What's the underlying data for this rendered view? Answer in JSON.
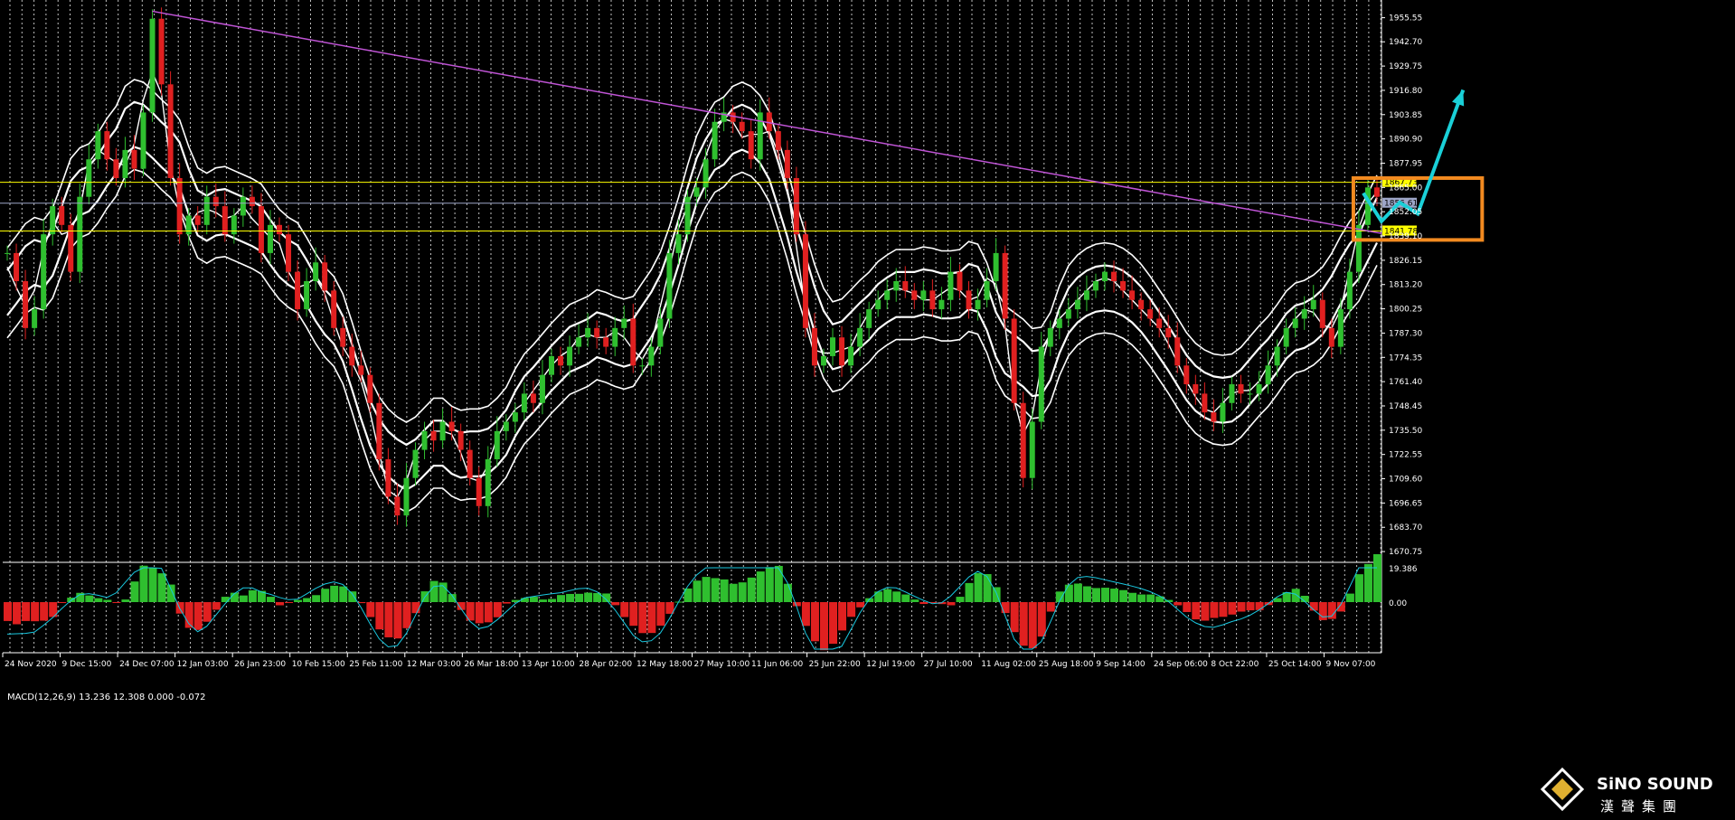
{
  "chart_data": [
    {
      "type": "candlestick",
      "name_panel": "main",
      "ylim": [
        1665.0,
        1965.0
      ],
      "yticks": [
        "1955.55",
        "1942.70",
        "1929.75",
        "1916.80",
        "1903.85",
        "1890.90",
        "1877.95",
        "1865.00",
        "1852.05",
        "1839.10",
        "1826.15",
        "1813.20",
        "1800.25",
        "1787.30",
        "1774.35",
        "1761.40",
        "1748.45",
        "1735.50",
        "1722.55",
        "1709.60",
        "1696.65",
        "1683.70",
        "1670.75"
      ],
      "xticks": [
        "24 Nov 2020",
        "9 Dec 15:00",
        "24 Dec 07:00",
        "12 Jan 03:00",
        "26 Jan 23:00",
        "10 Feb 15:00",
        "25 Feb 11:00",
        "12 Mar 03:00",
        "26 Mar 18:00",
        "13 Apr 10:00",
        "28 Apr 02:00",
        "12 May 18:00",
        "27 May 10:00",
        "11 Jun 06:00",
        "25 Jun 22:00",
        "12 Jul 19:00",
        "27 Jul 10:00",
        "11 Aug 02:00",
        "25 Aug 18:00",
        "9 Sep 14:00",
        "24 Sep 06:00",
        "8 Oct 22:00",
        "25 Oct 14:00",
        "9 Nov 07:00"
      ],
      "price_series": [
        1830,
        1815,
        1790,
        1800,
        1840,
        1855,
        1845,
        1820,
        1860,
        1880,
        1895,
        1880,
        1870,
        1885,
        1875,
        1905,
        1955,
        1920,
        1870,
        1840,
        1850,
        1845,
        1860,
        1855,
        1840,
        1850,
        1860,
        1855,
        1830,
        1845,
        1840,
        1820,
        1800,
        1815,
        1825,
        1810,
        1790,
        1780,
        1770,
        1765,
        1750,
        1720,
        1700,
        1690,
        1710,
        1725,
        1735,
        1730,
        1740,
        1735,
        1725,
        1710,
        1695,
        1720,
        1735,
        1740,
        1745,
        1755,
        1750,
        1765,
        1775,
        1770,
        1780,
        1785,
        1790,
        1785,
        1780,
        1790,
        1795,
        1770,
        1770,
        1780,
        1795,
        1830,
        1840,
        1860,
        1865,
        1880,
        1900,
        1905,
        1900,
        1895,
        1880,
        1905,
        1895,
        1885,
        1870,
        1840,
        1790,
        1770,
        1775,
        1785,
        1770,
        1780,
        1790,
        1800,
        1805,
        1810,
        1815,
        1810,
        1805,
        1810,
        1800,
        1805,
        1820,
        1810,
        1800,
        1805,
        1815,
        1830,
        1795,
        1750,
        1710,
        1740,
        1780,
        1790,
        1795,
        1800,
        1805,
        1810,
        1815,
        1820,
        1815,
        1810,
        1805,
        1800,
        1795,
        1790,
        1785,
        1770,
        1760,
        1755,
        1745,
        1740,
        1750,
        1760,
        1755,
        1755,
        1760,
        1770,
        1780,
        1790,
        1795,
        1800,
        1805,
        1790,
        1780,
        1800,
        1820,
        1845,
        1865,
        1860
      ],
      "hlines": [
        {
          "value": 1867.73,
          "label": "1867.73",
          "color": "#ffff00"
        },
        {
          "value": 1856.61,
          "label": "1856.61",
          "color": "#9ea6c8"
        },
        {
          "value": 1841.78,
          "label": "1841.78",
          "color": "#ffff00"
        }
      ],
      "trendline": {
        "from": [
          16,
          1959.0
        ],
        "to": [
          162,
          1840.5
        ],
        "color": "#c054d6"
      },
      "highlight_box": {
        "x_from": 149,
        "x_to": 162,
        "y_from": 1837.0,
        "y_to": 1870.0,
        "color": "#f28a20"
      },
      "forecast_path": [
        [
          149.5,
          1862.0
        ],
        [
          151.5,
          1847.0
        ],
        [
          153.5,
          1857.0
        ],
        [
          155.5,
          1851.0
        ],
        [
          160.5,
          1917.0
        ]
      ],
      "forecast_color": "#1ad0d8"
    },
    {
      "type": "histogram",
      "name_panel": "macd",
      "title": "MACD(12,26,9) 13.236 12.308 0.000 -0.072",
      "yticks": [
        "19.386",
        "0.00"
      ],
      "ylim": [
        -30,
        19.386
      ]
    }
  ],
  "colors": {
    "background": "#000000",
    "grid": "#ffffff",
    "axis_text": "#ffffff",
    "bull_candle": "#2fbf2f",
    "bear_candle": "#e02020",
    "bands": "#ffffff",
    "macd_signal": "#19c8e0"
  },
  "logo": {
    "text_en": "SiNO SOUND",
    "text_cn": "漢聲集團"
  }
}
